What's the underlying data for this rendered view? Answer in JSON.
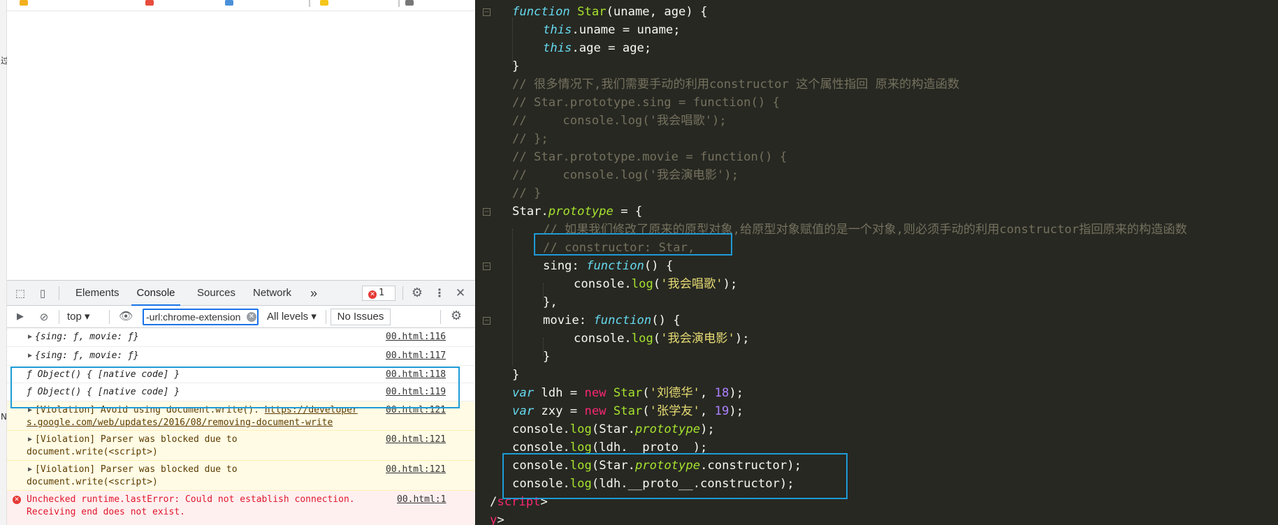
{
  "devtools": {
    "tabs": [
      "Elements",
      "Console",
      "Sources",
      "Network"
    ],
    "more_tabs": "»",
    "error_count": "1",
    "error_icon": "✕"
  },
  "toolbar": {
    "context": "top",
    "filter_value": "-url:chrome-extension",
    "levels": "All levels",
    "issues": "No Issues"
  },
  "console": {
    "rows": [
      {
        "msg": "{sing: ƒ, movie: ƒ}",
        "src": "00.html:116"
      },
      {
        "msg": "{sing: ƒ, movie: ƒ}",
        "src": "00.html:117"
      },
      {
        "msg": "ƒ Object() { [native code] }",
        "src": "00.html:118"
      },
      {
        "msg": "ƒ Object() { [native code] }",
        "src": "00.html:119"
      },
      {
        "msg_prefix": "[Violation] Avoid using document.write(). ",
        "link1": "https://developer",
        "link2": "s.google.com/web/updates/2016/08/removing-document-write",
        "src": "00.html:121"
      },
      {
        "msg1": "[Violation] Parser was blocked due to",
        "msg2": "document.write(<script>)",
        "src": "00.html:121"
      },
      {
        "msg1": "[Violation] Parser was blocked due to",
        "msg2": "document.write(<script>)",
        "src": "00.html:121"
      },
      {
        "msg1": "Unchecked runtime.lastError: Could not establish connection.",
        "msg2": "Receiving end does not exist.",
        "src": "00.html:1"
      }
    ]
  },
  "code": {
    "l1": {
      "kw": "function",
      "name": "Star",
      "rest": "(uname, age) {"
    },
    "l2": {
      "kw": "this",
      "rest": ".uname = uname;"
    },
    "l3": {
      "kw": "this",
      "rest": ".age = age;"
    },
    "l4": "}",
    "l5": "// 很多情况下,我们需要手动的利用constructor 这个属性指回 原来的构造函数",
    "l6": "// Star.prototype.sing = function() {",
    "l7": "//     console.log('我会唱歌');",
    "l8": "// };",
    "l9": "// Star.prototype.movie = function() {",
    "l10": "//     console.log('我会演电影');",
    "l11": "// }",
    "l12": {
      "a": "Star.",
      "b": "prototype",
      "c": " = {"
    },
    "l13": "// 如果我们修改了原来的原型对象,给原型对象赋值的是一个对象,则必须手动的利用constructor指回原来的构造函数",
    "l14": "// constructor: Star,",
    "l15": {
      "a": "sing",
      "b": ": ",
      "kw": "function",
      "c": "() {"
    },
    "l16": {
      "a": "console.",
      "b": "log",
      "c": "(",
      "s": "'我会唱歌'",
      "d": ");"
    },
    "l17": "},",
    "l18": {
      "a": "movie",
      "b": ": ",
      "kw": "function",
      "c": "() {"
    },
    "l19": {
      "a": "console.",
      "b": "log",
      "c": "(",
      "s": "'我会演电影'",
      "d": ");"
    },
    "l20": "}",
    "l21": "}",
    "l22": {
      "kw": "var",
      "a": " ldh = ",
      "op": "new",
      "fn": " Star",
      "c": "(",
      "s": "'刘德华'",
      "d": ", ",
      "n": "18",
      "e": ");"
    },
    "l23": {
      "kw": "var",
      "a": " zxy = ",
      "op": "new",
      "fn": " Star",
      "c": "(",
      "s": "'张学友'",
      "d": ", ",
      "n": "19",
      "e": ");"
    },
    "l24": {
      "a": "console.",
      "b": "log",
      "c": "(Star.",
      "p": "prototype",
      "d": ");"
    },
    "l25": {
      "a": "console.",
      "b": "log",
      "c": "(ldh.__proto__);"
    },
    "l26": {
      "a": "console.",
      "b": "log",
      "c": "(Star.",
      "p": "prototype",
      "d": ".constructor);"
    },
    "l27": {
      "a": "console.",
      "b": "log",
      "c": "(ldh.__proto__.constructor);"
    },
    "l28": {
      "a": "/",
      "t": "script",
      "b": ">"
    },
    "l29": {
      "t": "y",
      "b": ">"
    }
  },
  "colors": {
    "highlight_box": "#1e9bd7",
    "editor_bg": "#272822"
  }
}
